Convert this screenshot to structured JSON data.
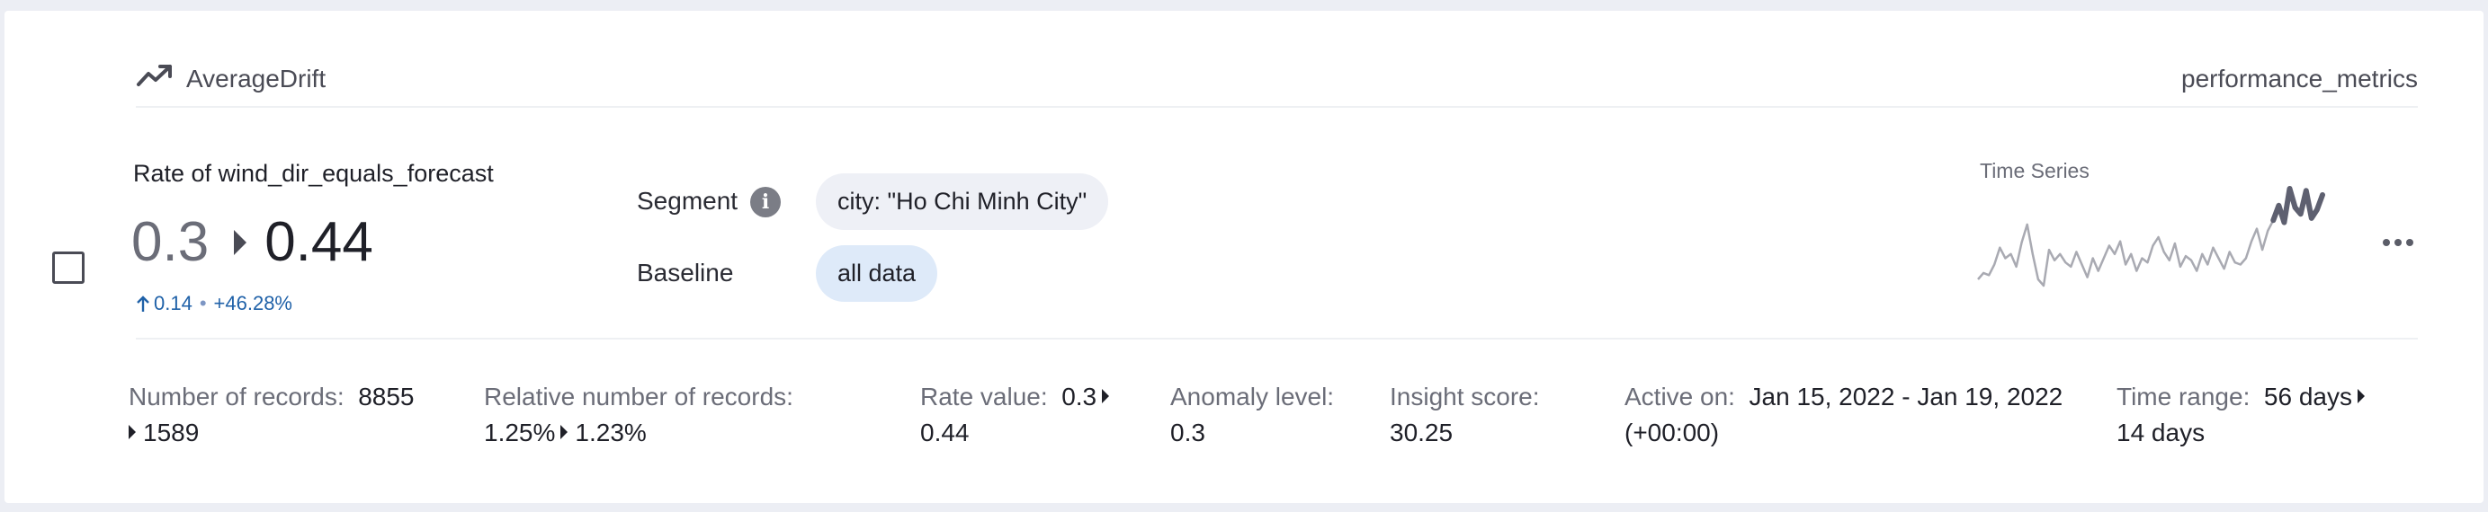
{
  "header": {
    "insight_type": "AverageDrift",
    "insight_icon": "trending-up-icon",
    "category": "performance_metrics"
  },
  "metric": {
    "title": "Rate of wind_dir_equals_forecast",
    "old_value": "0.3",
    "new_value": "0.44",
    "delta_abs": "0.14",
    "delta_sep": "•",
    "delta_pct": "+46.28%"
  },
  "segment": {
    "label": "Segment",
    "info_glyph": "i",
    "value": "city: \"Ho Chi Minh City\""
  },
  "baseline": {
    "label": "Baseline",
    "value": "all data"
  },
  "timeseries": {
    "label": "Time Series",
    "values": [
      10,
      16,
      14,
      24,
      40,
      30,
      34,
      22,
      45,
      62,
      34,
      10,
      4,
      38,
      28,
      34,
      26,
      22,
      36,
      24,
      12,
      30,
      18,
      30,
      42,
      34,
      46,
      24,
      34,
      18,
      30,
      26,
      42,
      50,
      36,
      28,
      44,
      22,
      32,
      28,
      18,
      34,
      24,
      40,
      30,
      20,
      36,
      26,
      24,
      30,
      46,
      58,
      38,
      56,
      66,
      80,
      64,
      96,
      78,
      72,
      94,
      68,
      76,
      90
    ],
    "highlight_from_index": 54,
    "color_base": "#a9aab2",
    "color_highlight": "#5e6070"
  },
  "stats": {
    "records": {
      "label": "Number of records:",
      "old": "8855",
      "new": "1589"
    },
    "relative_records": {
      "label": "Relative number of records:",
      "old": "1.25%",
      "new": "1.23%"
    },
    "rate_value": {
      "label": "Rate value:",
      "old": "0.3",
      "new": "0.44"
    },
    "anomaly": {
      "label": "Anomaly level:",
      "value": "0.3"
    },
    "insight_score": {
      "label": "Insight score:",
      "value": "30.25"
    },
    "active_on": {
      "label": "Active on:",
      "value": "Jan 15, 2022 - Jan 19, 2022",
      "tz": "(+00:00)"
    },
    "time_range": {
      "label": "Time range:",
      "old": "56 days",
      "new": "14 days"
    }
  },
  "colors": {
    "accent": "#1f61a8",
    "chip_segment": "#eef0f6",
    "chip_baseline": "#deeaf9",
    "background": "#eceef4"
  }
}
